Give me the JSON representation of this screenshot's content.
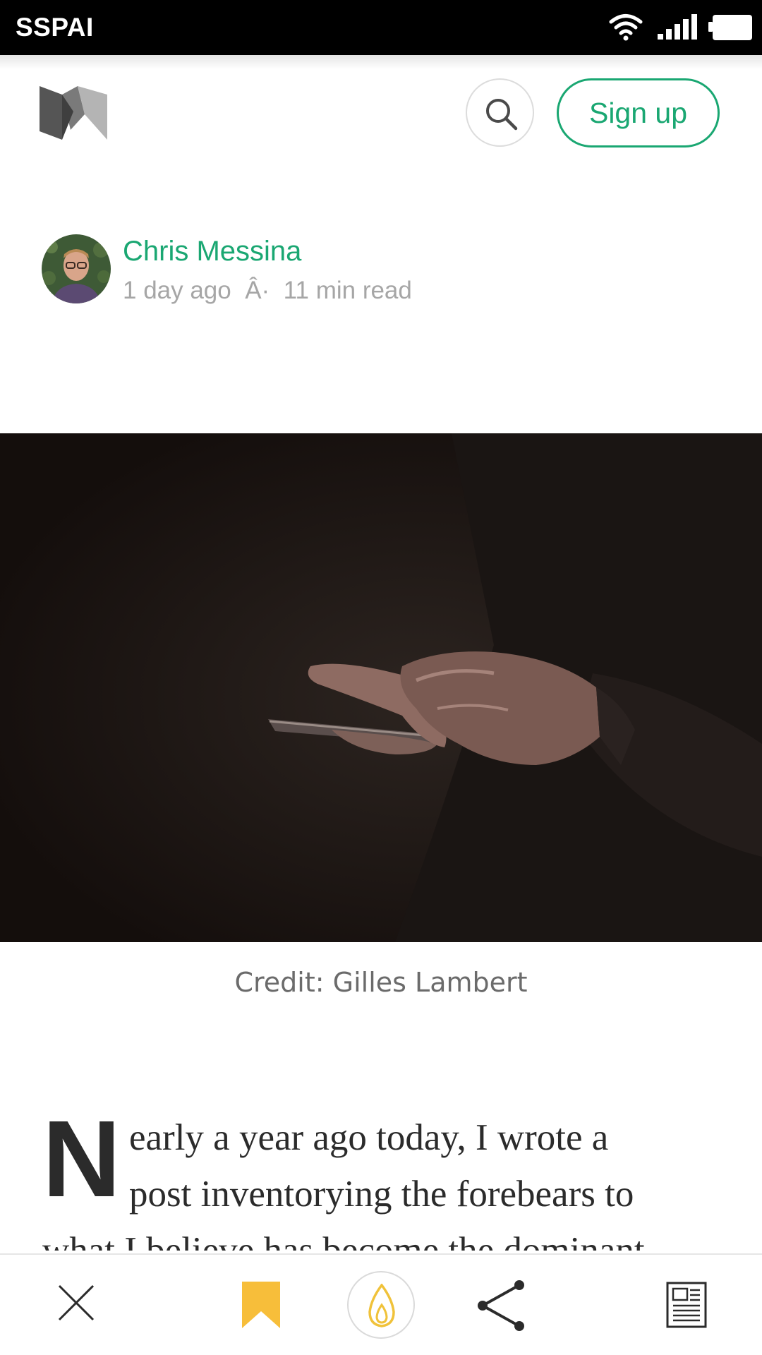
{
  "status_bar": {
    "carrier_label": "SSPAI"
  },
  "header": {
    "logo_icon": "medium-logo",
    "search_icon": "search-icon",
    "signup_label": "Sign up"
  },
  "author": {
    "name": "Chris Messina",
    "meta": "1 day ago  Â·  11 min read"
  },
  "hero": {
    "caption": "Credit: Gilles Lambert"
  },
  "article": {
    "drop_cap": "N",
    "line_1": "early a year ago today, I wrote a",
    "line_2": "post inventorying the forebears to",
    "line_3": "what I believe has become the dominant"
  },
  "bottom_bar": {
    "icons": [
      "close-icon",
      "bookmark-icon",
      "recommend-icon",
      "share-icon",
      "reader-icon"
    ]
  },
  "colors": {
    "accent": "#1aa772",
    "bookmark": "#f7be3a",
    "recommend": "#f0c23a",
    "text": "#2b2b2b"
  }
}
